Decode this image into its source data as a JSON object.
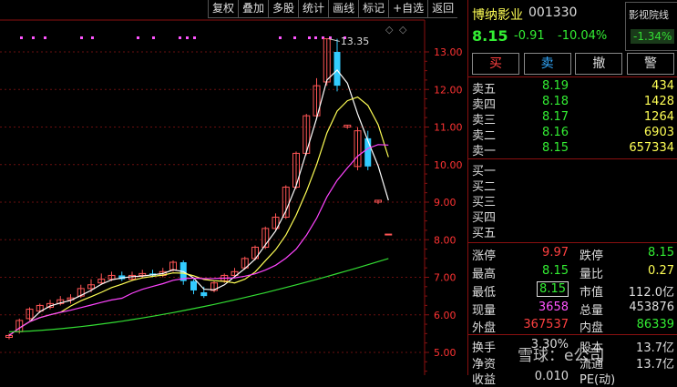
{
  "toolbar": [
    "复权",
    "叠加",
    "多股",
    "统计",
    "画线",
    "标记",
    "+自选",
    "返回"
  ],
  "chart_data": {
    "type": "candlestick",
    "y_ticks": [
      "13.00",
      "12.00",
      "11.00",
      "10.00",
      "9.00",
      "8.00",
      "7.00",
      "6.00",
      "5.00"
    ],
    "high_label": "13.35",
    "candles": [
      {
        "o": 5.4,
        "c": 5.45,
        "h": 5.5,
        "l": 5.35
      },
      {
        "o": 5.55,
        "c": 5.85,
        "h": 5.9,
        "l": 5.5
      },
      {
        "o": 5.9,
        "c": 6.15,
        "h": 6.2,
        "l": 5.85
      },
      {
        "o": 6.1,
        "c": 6.25,
        "h": 6.3,
        "l": 6.05
      },
      {
        "o": 6.2,
        "c": 6.3,
        "h": 6.4,
        "l": 6.15
      },
      {
        "o": 6.3,
        "c": 6.4,
        "h": 6.5,
        "l": 6.25
      },
      {
        "o": 6.4,
        "c": 6.45,
        "h": 6.55,
        "l": 6.3
      },
      {
        "o": 6.5,
        "c": 6.7,
        "h": 6.8,
        "l": 6.45
      },
      {
        "o": 6.7,
        "c": 6.8,
        "h": 6.95,
        "l": 6.6
      },
      {
        "o": 6.85,
        "c": 6.95,
        "h": 7.1,
        "l": 6.8
      },
      {
        "o": 6.95,
        "c": 7.05,
        "h": 7.15,
        "l": 6.9
      },
      {
        "o": 7.05,
        "c": 6.95,
        "h": 7.15,
        "l": 6.9
      },
      {
        "o": 6.95,
        "c": 7.05,
        "h": 7.15,
        "l": 6.9
      },
      {
        "o": 7.05,
        "c": 7.1,
        "h": 7.2,
        "l": 7.0
      },
      {
        "o": 7.1,
        "c": 7.05,
        "h": 7.2,
        "l": 7.0
      },
      {
        "o": 7.05,
        "c": 7.15,
        "h": 7.25,
        "l": 7.0
      },
      {
        "o": 7.2,
        "c": 7.4,
        "h": 7.45,
        "l": 7.15
      },
      {
        "o": 7.4,
        "c": 6.9,
        "h": 7.45,
        "l": 6.8
      },
      {
        "o": 6.9,
        "c": 6.65,
        "h": 6.95,
        "l": 6.55
      },
      {
        "o": 6.6,
        "c": 6.5,
        "h": 6.75,
        "l": 6.45
      },
      {
        "o": 6.65,
        "c": 6.85,
        "h": 6.9,
        "l": 6.6
      },
      {
        "o": 6.9,
        "c": 7.05,
        "h": 7.1,
        "l": 6.85
      },
      {
        "o": 7.05,
        "c": 7.15,
        "h": 7.25,
        "l": 7.0
      },
      {
        "o": 7.25,
        "c": 7.5,
        "h": 7.55,
        "l": 7.2
      },
      {
        "o": 7.5,
        "c": 7.8,
        "h": 7.85,
        "l": 7.45
      },
      {
        "o": 7.8,
        "c": 8.3,
        "h": 8.35,
        "l": 7.75
      },
      {
        "o": 8.3,
        "c": 8.6,
        "h": 8.7,
        "l": 8.25
      },
      {
        "o": 8.6,
        "c": 9.4,
        "h": 9.45,
        "l": 8.55
      },
      {
        "o": 9.4,
        "c": 10.3,
        "h": 10.35,
        "l": 9.35
      },
      {
        "o": 10.3,
        "c": 11.3,
        "h": 11.35,
        "l": 10.25
      },
      {
        "o": 11.3,
        "c": 12.1,
        "h": 12.3,
        "l": 11.2
      },
      {
        "o": 12.2,
        "c": 13.35,
        "h": 13.35,
        "l": 12.1
      },
      {
        "o": 13.0,
        "c": 12.1,
        "h": 13.35,
        "l": 11.95
      },
      {
        "o": 11.0,
        "c": 11.05,
        "h": 11.05,
        "l": 10.95
      },
      {
        "o": 9.95,
        "c": 10.9,
        "h": 11.0,
        "l": 9.85
      },
      {
        "o": 10.7,
        "c": 9.95,
        "h": 10.9,
        "l": 9.85
      },
      {
        "o": 9.0,
        "c": 9.05,
        "h": 9.05,
        "l": 8.95
      },
      {
        "o": 8.15,
        "c": 8.15,
        "h": 8.15,
        "l": 8.15
      }
    ]
  },
  "stock": {
    "name": "博纳影业",
    "code": "001330",
    "price": "8.15",
    "change": "-0.91",
    "pct": "-10.04%",
    "sector": "影视院线",
    "sector_pct": "-1.34%"
  },
  "buttons": {
    "buy": "买",
    "sell": "卖",
    "cancel": "撤",
    "alert": "警"
  },
  "asks": [
    {
      "label": "卖五",
      "price": "8.19",
      "vol": "434"
    },
    {
      "label": "卖四",
      "price": "8.18",
      "vol": "1428"
    },
    {
      "label": "卖三",
      "price": "8.17",
      "vol": "1264"
    },
    {
      "label": "卖二",
      "price": "8.16",
      "vol": "6903"
    },
    {
      "label": "卖一",
      "price": "8.15",
      "vol": "657334"
    }
  ],
  "bids": [
    "买一",
    "买二",
    "买三",
    "买四",
    "买五"
  ],
  "stats": [
    {
      "l1": "涨停",
      "v1": "9.97",
      "l2": "跌停",
      "v2": "8.15"
    },
    {
      "l1": "最高",
      "v1": "8.15",
      "l2": "量比",
      "v2": "0.27"
    },
    {
      "l1": "最低",
      "v1": "8.15",
      "l2": "市值",
      "v2": "112.0亿"
    },
    {
      "l1": "现量",
      "v1": "3658",
      "l2": "总量",
      "v2": "453876"
    },
    {
      "l1": "外盘",
      "v1": "367537",
      "l2": "内盘",
      "v2": "86339"
    }
  ],
  "stats2": [
    {
      "l1": "换手",
      "v1": "3.30%",
      "l2": "股本",
      "v2": "13.7亿"
    },
    {
      "l1": "净资",
      "v1": "",
      "l2": "流通",
      "v2": "13.7亿"
    },
    {
      "l1": "收益",
      "v1": "0.010",
      "l2": "PE(动)",
      "v2": ""
    }
  ],
  "watermark": {
    "site": "雪球",
    "sep": "：",
    "author": "e公司"
  }
}
